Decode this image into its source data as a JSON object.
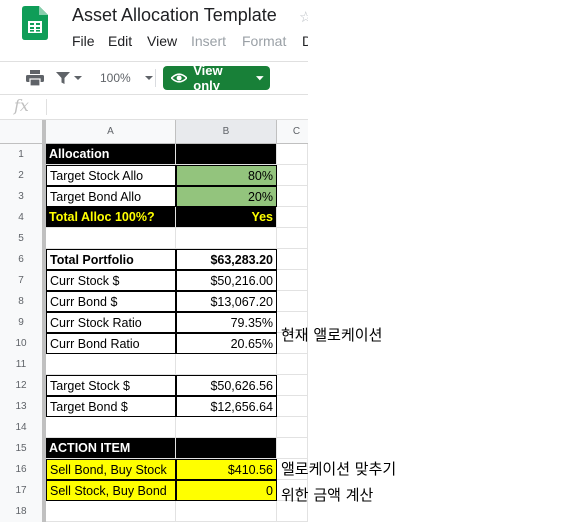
{
  "doc_title": "Asset Allocation Template",
  "menu": [
    "File",
    "Edit",
    "View",
    "Insert",
    "Format",
    "D"
  ],
  "toolbar": {
    "zoom": "100%",
    "view_only": "View only"
  },
  "formula_bar": {
    "fx": "fx"
  },
  "columns": [
    "A",
    "B",
    "C"
  ],
  "rows": [
    {
      "n": "1",
      "a": "Allocation",
      "b": ""
    },
    {
      "n": "2",
      "a": "Target Stock Allo",
      "b": "80%"
    },
    {
      "n": "3",
      "a": "Target Bond Allo",
      "b": "20%"
    },
    {
      "n": "4",
      "a": "Total Alloc 100%?",
      "b": "Yes"
    },
    {
      "n": "5",
      "a": "",
      "b": ""
    },
    {
      "n": "6",
      "a": "Total Portfolio",
      "b": "$63,283.20"
    },
    {
      "n": "7",
      "a": "Curr Stock $",
      "b": "$50,216.00"
    },
    {
      "n": "8",
      "a": "Curr Bond $",
      "b": "$13,067.20"
    },
    {
      "n": "9",
      "a": "Curr Stock Ratio",
      "b": "79.35%"
    },
    {
      "n": "10",
      "a": "Curr Bond Ratio",
      "b": "20.65%"
    },
    {
      "n": "11",
      "a": "",
      "b": ""
    },
    {
      "n": "12",
      "a": "Target Stock $",
      "b": "$50,626.56"
    },
    {
      "n": "13",
      "a": "Target Bond $",
      "b": "$12,656.64"
    },
    {
      "n": "14",
      "a": "",
      "b": ""
    },
    {
      "n": "15",
      "a": "ACTION ITEM",
      "b": ""
    },
    {
      "n": "16",
      "a": "Sell Bond, Buy Stock",
      "b": "$410.56"
    },
    {
      "n": "17",
      "a": "Sell Stock, Buy Bond",
      "b": "0"
    },
    {
      "n": "18",
      "a": "",
      "b": ""
    }
  ],
  "notes": {
    "current_allocation": "현재 앨로케이션",
    "rebalance_line1": "앨로케이션 맞추기",
    "rebalance_line2": "위한 금액 계산"
  },
  "colors": {
    "green_fill": "#93c47d",
    "yellow_fill": "#ffff00",
    "view_only_button": "#188038"
  }
}
